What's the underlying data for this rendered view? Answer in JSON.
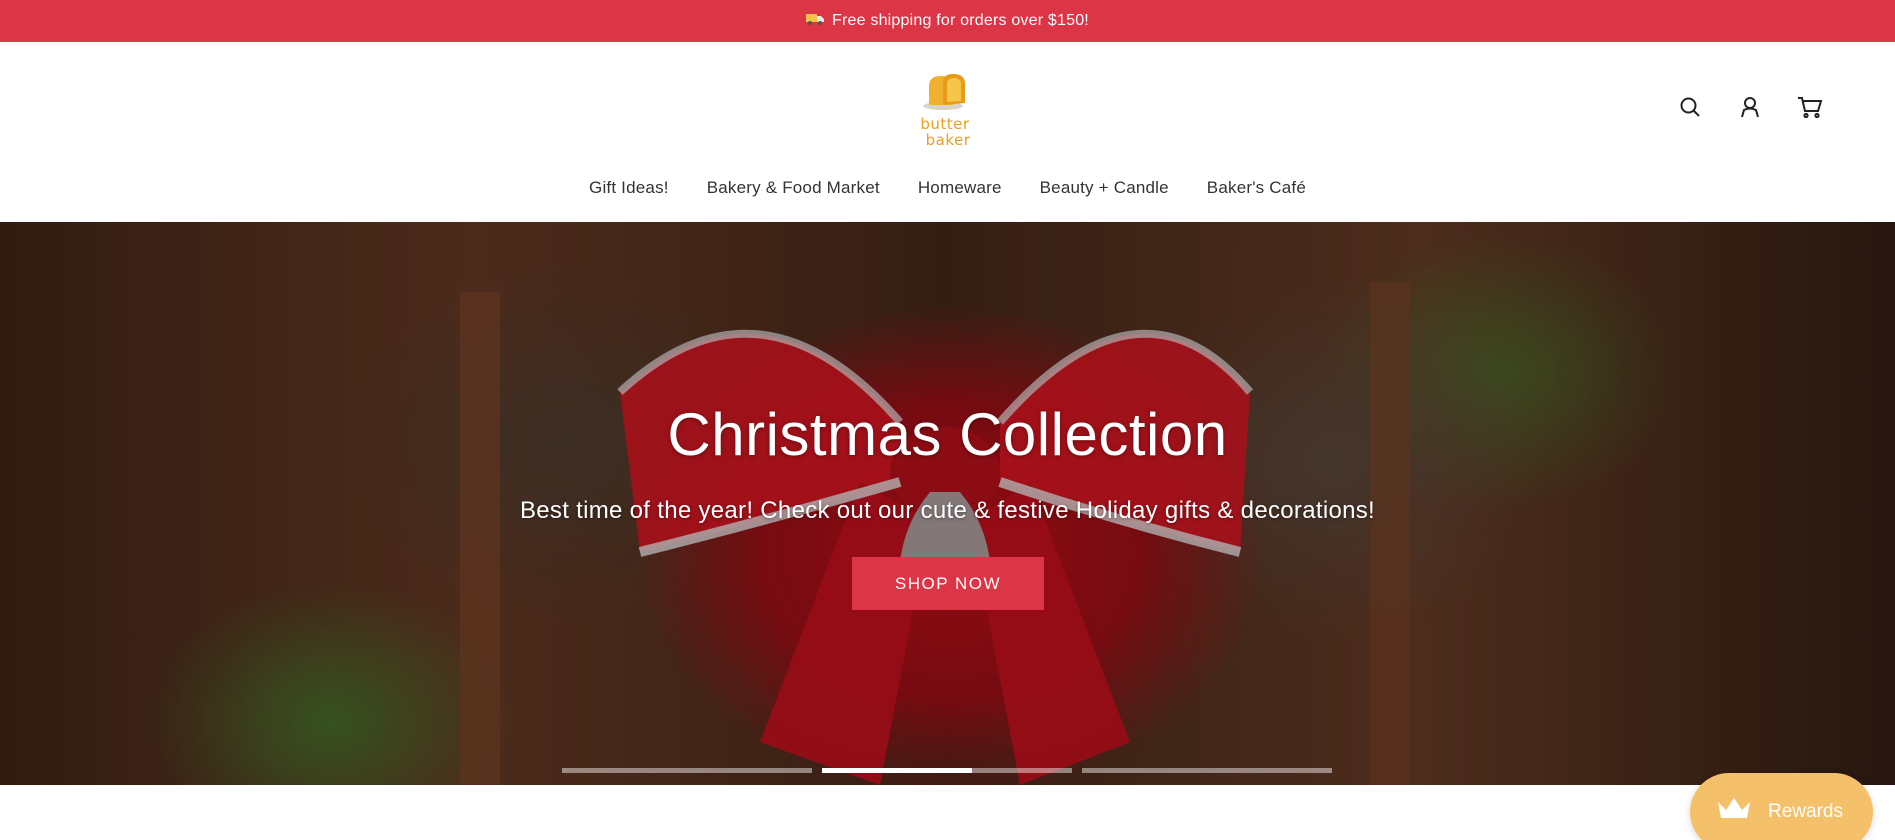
{
  "announcement": {
    "text": "Free shipping for orders over $150!",
    "icon": "truck-icon",
    "background": "#dc3545"
  },
  "logo": {
    "line1": "butter",
    "line2": "baker",
    "color": "#e8a020"
  },
  "header_icons": [
    "search-icon",
    "account-icon",
    "cart-icon"
  ],
  "nav": {
    "items": [
      {
        "label": "Gift Ideas!"
      },
      {
        "label": "Bakery & Food Market"
      },
      {
        "label": "Homeware"
      },
      {
        "label": "Beauty + Candle"
      },
      {
        "label": "Baker's Café"
      }
    ]
  },
  "hero": {
    "title": "Christmas Collection",
    "subtitle": "Best time of the year! Check out our cute & festive Holiday gifts & decorations!",
    "button_label": "SHOP NOW",
    "button_color": "#dc3545",
    "slides": [
      {
        "progress": 0
      },
      {
        "progress": 0.6
      },
      {
        "progress": 0
      }
    ],
    "active_slide": 2
  },
  "rewards": {
    "label": "Rewards",
    "icon": "crown-icon",
    "color": "#f5c06a"
  }
}
